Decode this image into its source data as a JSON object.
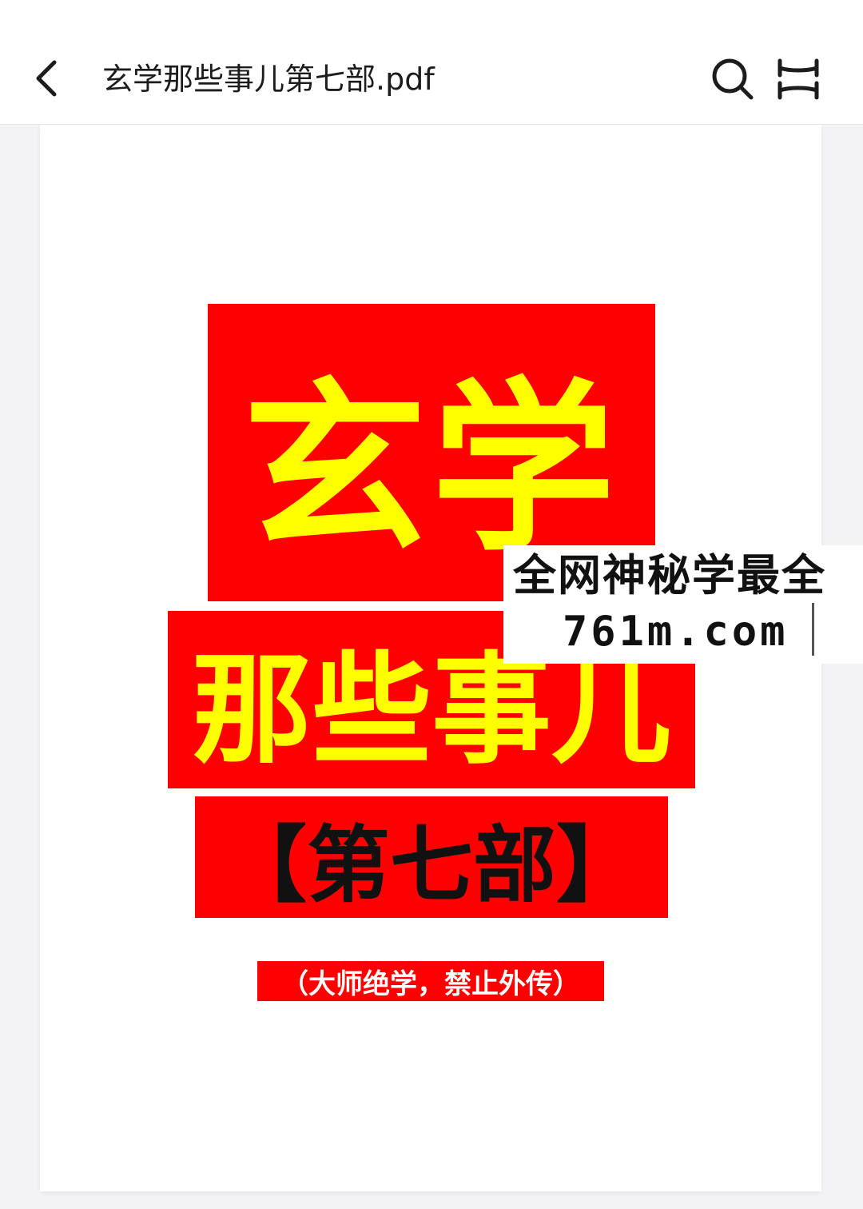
{
  "header": {
    "title": "玄学那些事儿第七部.pdf",
    "icons": {
      "back": "chevron-left-icon",
      "search": "search-icon",
      "fullscreen": "fullscreen-icon"
    }
  },
  "page": {
    "lines": [
      "玄学",
      "那些事儿",
      "【第七部】",
      "（大师绝学，禁止外传）"
    ],
    "watermark": {
      "line1": "全网神秘学最全",
      "line2": "761m.com"
    }
  },
  "colors": {
    "block_red": "#ff0000",
    "title_yellow": "#ffff00",
    "subtitle_black": "#111111",
    "note_white": "#ffffff"
  }
}
